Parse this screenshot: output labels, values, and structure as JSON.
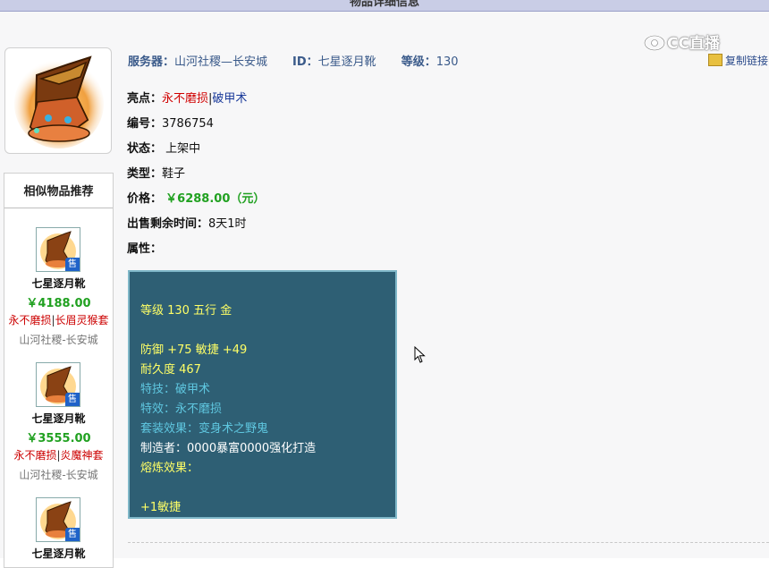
{
  "topbar": {
    "title": "物品详细信息"
  },
  "watermark": {
    "text": "CC直播"
  },
  "item": {
    "header": {
      "server_label": "服务器：",
      "server_value": "山河社稷—长安城",
      "id_label": "ID：",
      "id_value": "七星逐月靴",
      "level_label": "等级：",
      "level_value": "130"
    },
    "copy_link": "复制链接",
    "highlight_label": "亮点：",
    "highlight_1": "永不磨损",
    "highlight_sep": "|",
    "highlight_2": "破甲术",
    "number_label": "编号：",
    "number_value": "3786754",
    "status_label": "状态：",
    "status_value": "上架中",
    "type_label": "类型：",
    "type_value": "鞋子",
    "price_label": "价格：",
    "price_value": "￥6288.00（元）",
    "remaining_label": "出售剩余时间：",
    "remaining_value": "8天1时",
    "attr_label": "属性："
  },
  "attributes": [
    {
      "text": "等级 130 五行 金",
      "color": "#ffff66"
    },
    {
      "text": "防御 +75 敏捷 +49",
      "color": "#ffff66"
    },
    {
      "text": "耐久度 467",
      "color": "#ffff66"
    },
    {
      "text": "特技：破甲术",
      "color": "#5fc7e0"
    },
    {
      "text": "特效：永不磨损",
      "color": "#5fc7e0"
    },
    {
      "text": "套装效果：变身术之野鬼",
      "color": "#5fc7e0"
    },
    {
      "text": "制造者：0000暴富0000强化打造",
      "color": "#ffffff"
    },
    {
      "text": "熔炼效果：",
      "color": "#ffff66"
    },
    {
      "text": "+1敏捷",
      "color": "#ffff66"
    }
  ],
  "similar": {
    "title": "相似物品推荐",
    "badge": "售",
    "items": [
      {
        "name": "七星逐月靴",
        "price": "￥4188.00",
        "tag1": "永不磨损",
        "sep": "|",
        "tag2": "长眉灵猴套",
        "server": "山河社稷-长安城"
      },
      {
        "name": "七星逐月靴",
        "price": "￥3555.00",
        "tag1": "永不磨损",
        "sep": "|",
        "tag2": "炎魔神套",
        "server": "山河社稷-长安城"
      },
      {
        "name": "七星逐月靴",
        "price": "",
        "tag1": "",
        "sep": "",
        "tag2": "",
        "server": ""
      }
    ]
  },
  "colors": {
    "accent_green": "#21a121",
    "highlight_red": "#d00000",
    "attr_bg": "#2e5f74",
    "topbar": "#c9cde6"
  }
}
